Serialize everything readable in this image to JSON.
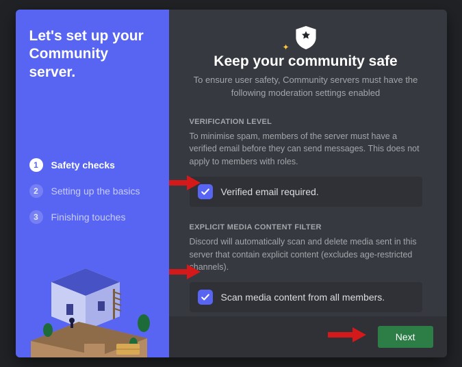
{
  "sidebar": {
    "title": "Let's set up your Community server.",
    "steps": [
      {
        "num": "1",
        "label": "Safety checks"
      },
      {
        "num": "2",
        "label": "Setting up the basics"
      },
      {
        "num": "3",
        "label": "Finishing touches"
      }
    ]
  },
  "main": {
    "title": "Keep your community safe",
    "subtitle": "To ensure user safety, Community servers must have the following moderation settings enabled"
  },
  "verification": {
    "label": "VERIFICATION LEVEL",
    "desc": "To minimise spam, members of the server must have a verified email before they can send messages. This does not apply to members with roles.",
    "checkbox_label": "Verified email required.",
    "checked": true
  },
  "explicit": {
    "label": "EXPLICIT MEDIA CONTENT FILTER",
    "desc": "Discord will automatically scan and delete media sent in this server that contain explicit content (excludes age-restricted channels).",
    "checkbox_label": "Scan media content from all members.",
    "checked": true
  },
  "buttons": {
    "next": "Next"
  },
  "colors": {
    "accent": "#5865f2",
    "success": "#2d7d46",
    "bg_dark": "#36393f"
  }
}
